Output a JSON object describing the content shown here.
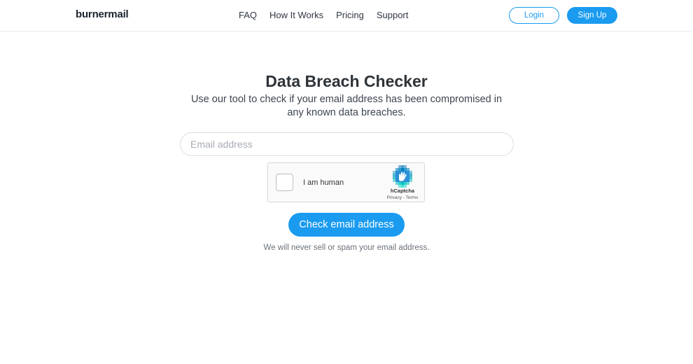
{
  "header": {
    "logo": "burnermail",
    "nav": [
      "FAQ",
      "How It Works",
      "Pricing",
      "Support"
    ],
    "login_label": "Login",
    "signup_label": "Sign Up"
  },
  "main": {
    "title": "Data Breach Checker",
    "subtitle": "Use our tool to check if your email address has been compromised in any known data breaches.",
    "email_placeholder": "Email address",
    "email_value": "",
    "captcha": {
      "label": "I am human",
      "brand": "hCaptcha",
      "links": "Privacy - Terms",
      "icon": "hcaptcha-logo-icon"
    },
    "check_button_label": "Check email address",
    "note": "We will never sell or spam your email address."
  },
  "colors": {
    "accent": "#1a9bf0",
    "text_dark": "#2d3338",
    "border": "#d9dde2"
  }
}
